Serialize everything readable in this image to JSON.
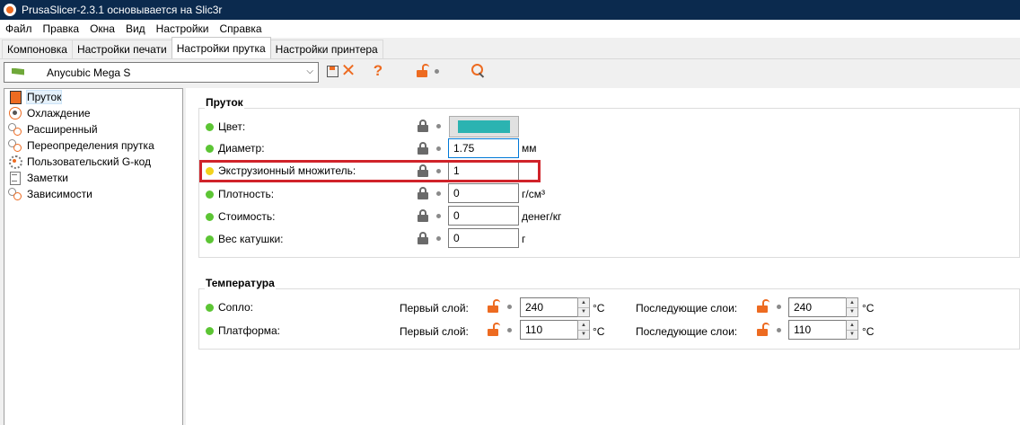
{
  "window": {
    "title": "PrusaSlicer-2.3.1 основывается на Slic3r"
  },
  "menu": [
    "Файл",
    "Правка",
    "Окна",
    "Вид",
    "Настройки",
    "Справка"
  ],
  "tabs": [
    {
      "label": "Компоновка",
      "active": false
    },
    {
      "label": "Настройки печати",
      "active": false
    },
    {
      "label": "Настройки прутка",
      "active": true
    },
    {
      "label": "Настройки принтера",
      "active": false
    }
  ],
  "toolbar": {
    "preset_name": "Anycubic Mega S",
    "icons": [
      "save-icon",
      "delete-icon",
      "help-icon",
      "lock-icon",
      "search-icon"
    ]
  },
  "sidebar": {
    "items": [
      {
        "label": "Пруток",
        "icon": "spool-icon",
        "selected": true
      },
      {
        "label": "Охлаждение",
        "icon": "fan-icon",
        "selected": false
      },
      {
        "label": "Расширенный",
        "icon": "gears-icon",
        "selected": false
      },
      {
        "label": "Переопределения прутка",
        "icon": "gears-icon",
        "selected": false
      },
      {
        "label": "Пользовательский G-код",
        "icon": "cog-icon",
        "selected": false
      },
      {
        "label": "Заметки",
        "icon": "note-icon",
        "selected": false
      },
      {
        "label": "Зависимости",
        "icon": "gears-icon",
        "selected": false
      }
    ]
  },
  "filament": {
    "title": "Пруток",
    "color": {
      "label": "Цвет:",
      "value": "#2bb3b1"
    },
    "diameter": {
      "label": "Диаметр:",
      "value": "1.75",
      "unit": "мм"
    },
    "extrusion_multiplier": {
      "label": "Экструзионный множитель:",
      "value": "1"
    },
    "density": {
      "label": "Плотность:",
      "value": "0",
      "unit": "г/см³"
    },
    "cost": {
      "label": "Стоимость:",
      "value": "0",
      "unit": "денег/кг"
    },
    "spool_weight": {
      "label": "Вес катушки:",
      "value": "0",
      "unit": "г"
    }
  },
  "temperature": {
    "title": "Температура",
    "first_layer_label": "Первый слой:",
    "other_layers_label": "Последующие слои:",
    "unit": "°C",
    "nozzle": {
      "label": "Сопло:",
      "first_layer": "240",
      "other_layers": "240"
    },
    "bed": {
      "label": "Платформа:",
      "first_layer": "110",
      "other_layers": "110"
    }
  },
  "colors": {
    "accent": "#ed6b21",
    "status_green": "#5cc534",
    "status_yellow": "#f2d21c",
    "highlight_red": "#d0232a",
    "titlebar": "#0b2a4e"
  }
}
